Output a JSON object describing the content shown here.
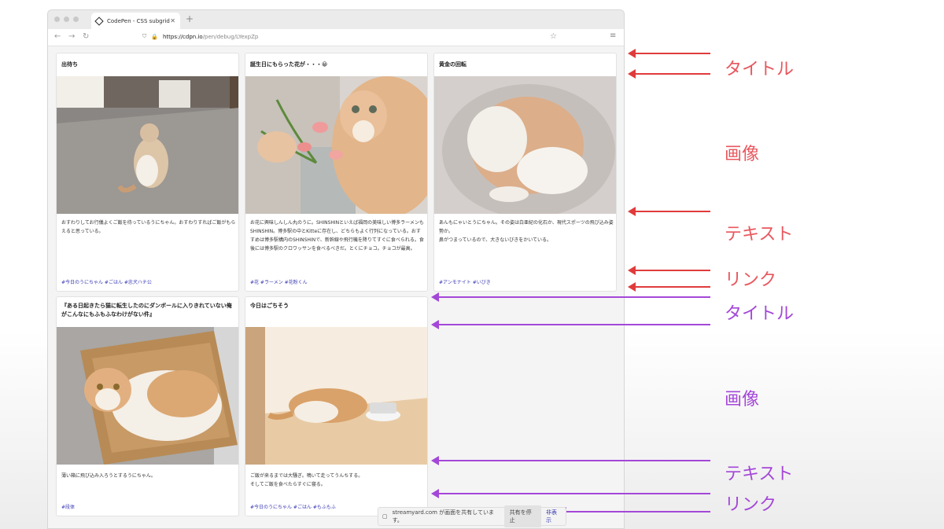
{
  "browser": {
    "tab_title": "CodePen - CSS subgrid",
    "url_host": "https://cdpn.io",
    "url_path": "/pen/debug/LYexpZp"
  },
  "cards": [
    {
      "title": "出待ち",
      "text": "おすわりしてお行儀よくご飯を待っているうにちゃん。おすわりすればご飯がもらえると思っている。",
      "links": "#今日のうにちゃん #ごはん #忠犬ハチ公"
    },
    {
      "title": "誕生日にもらった花が・・・😀",
      "text": "お花に興味しんしん丸のうに。SHINSHINといえば福岡の美味しい博多ラーメンもSHINSHIN。博多駅の中とKitteに存在し、どちらもよく行列になっている。おすすめは博多駅構内のSHINSHINで、新幹線や飛行機を降りてすぐに食べられる。食後には博多駅のクロワッサンを食べるべきだ。とくにチョコ。チョコが最高。",
      "links": "#花 #ラーメン #花粉くん"
    },
    {
      "title": "黄金の回転",
      "text": "あんもにゃいとうにちゃん。その姿は白亜紀の化石か、現代スポーツの飛び込み姿勢か。\n鼻がつまっているので、大きないびきをかいている。",
      "links": "#アンモナイト #いびき"
    },
    {
      "title": "『ある日起きたら猫に転生したのにダンボールに入りきれていない俺がこんなにもふもふなわけがない件』",
      "text": "薄い箱に飛び込み入ろうとするうにちゃん。",
      "links": "#段体"
    },
    {
      "title": "今日はごちそう",
      "text": "ご飯が来るまでは大騒ぎ。鳴いて走ってうんちする。\nそしてご飯を食べたらすぐに寝る。",
      "links": "#今日のうにちゃん #ごはん #もふもふ"
    }
  ],
  "annotations": {
    "title1": "タイトル",
    "image1": "画像",
    "text1": "テキスト",
    "link1": "リンク",
    "title2": "タイトル",
    "image2": "画像",
    "text2": "テキスト",
    "link2": "リンク"
  },
  "share_bar": {
    "message": "streamyard.com が画面を共有しています。",
    "stop_label": "共有を停止",
    "hide_label": "非表示"
  },
  "colors": {
    "red": "#e8575e",
    "purple": "#a447d8",
    "link": "#3b3bb5"
  }
}
